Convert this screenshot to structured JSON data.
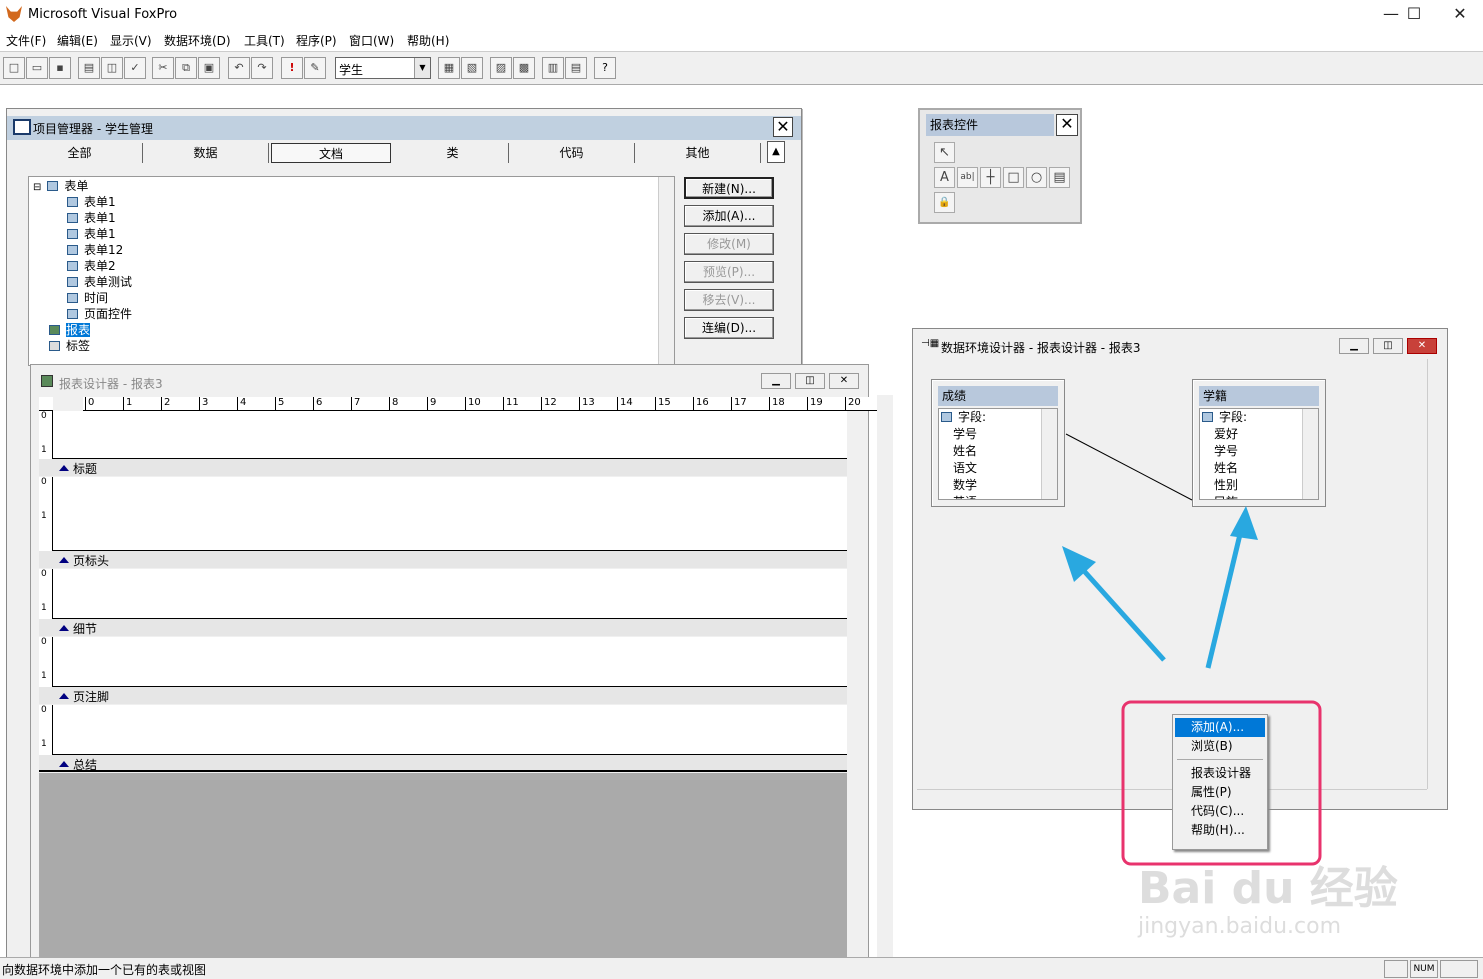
{
  "app": {
    "title": "Microsoft Visual FoxPro"
  },
  "menu": [
    "文件(F)",
    "编辑(E)",
    "显示(V)",
    "数据环境(D)",
    "工具(T)",
    "程序(P)",
    "窗口(W)",
    "帮助(H)"
  ],
  "toolbar": {
    "combo_value": "学生"
  },
  "project_manager": {
    "title": "项目管理器 - 学生管理",
    "tabs": [
      "全部",
      "数据",
      "文档",
      "类",
      "代码",
      "其他"
    ],
    "selected_tab": "文档",
    "tree": {
      "root": "表单",
      "children": [
        "表单1",
        "表单1",
        "表单1",
        "表单12",
        "表单2",
        "表单测试",
        "时间",
        "页面控件"
      ],
      "reports": "报表",
      "labels": "标签"
    },
    "buttons": {
      "new": "新建(N)...",
      "add": "添加(A)...",
      "modify": "修改(M)",
      "preview": "预览(P)...",
      "remove": "移去(V)...",
      "build": "连编(D)..."
    }
  },
  "report_designer": {
    "title": "报表设计器 - 报表3",
    "ruler": [
      "0",
      "1",
      "2",
      "3",
      "4",
      "5",
      "6",
      "7",
      "8",
      "9",
      "10",
      "11",
      "12",
      "13",
      "14",
      "15",
      "16",
      "17",
      "18",
      "19",
      "20"
    ],
    "bands": [
      "标题",
      "页标头",
      "细节",
      "页注脚",
      "总结"
    ],
    "vruler": {
      "zero": "0",
      "one": "1"
    }
  },
  "report_controls": {
    "title": "报表控件"
  },
  "data_env": {
    "title": "数据环境设计器 - 报表设计器 - 报表3",
    "tables": [
      {
        "name": "成绩",
        "fields": [
          "字段:",
          "学号",
          "姓名",
          "语文",
          "数学",
          "英语"
        ]
      },
      {
        "name": "学籍",
        "fields": [
          "字段:",
          "爱好",
          "学号",
          "姓名",
          "性别",
          "民族"
        ]
      }
    ]
  },
  "context_menu": {
    "items": [
      "添加(A)...",
      "浏览(B)",
      "报表设计器",
      "属性(P)",
      "代码(C)...",
      "帮助(H)..."
    ],
    "selected": "添加(A)..."
  },
  "status": {
    "text": "向数据环境中添加一个已有的表或视图",
    "num": "NUM"
  },
  "watermark": {
    "text": "jingyan.baidu.com"
  },
  "colors": {
    "highlight": "#0078d7",
    "arrow": "#29a8e0",
    "callout": "#e8336d"
  }
}
